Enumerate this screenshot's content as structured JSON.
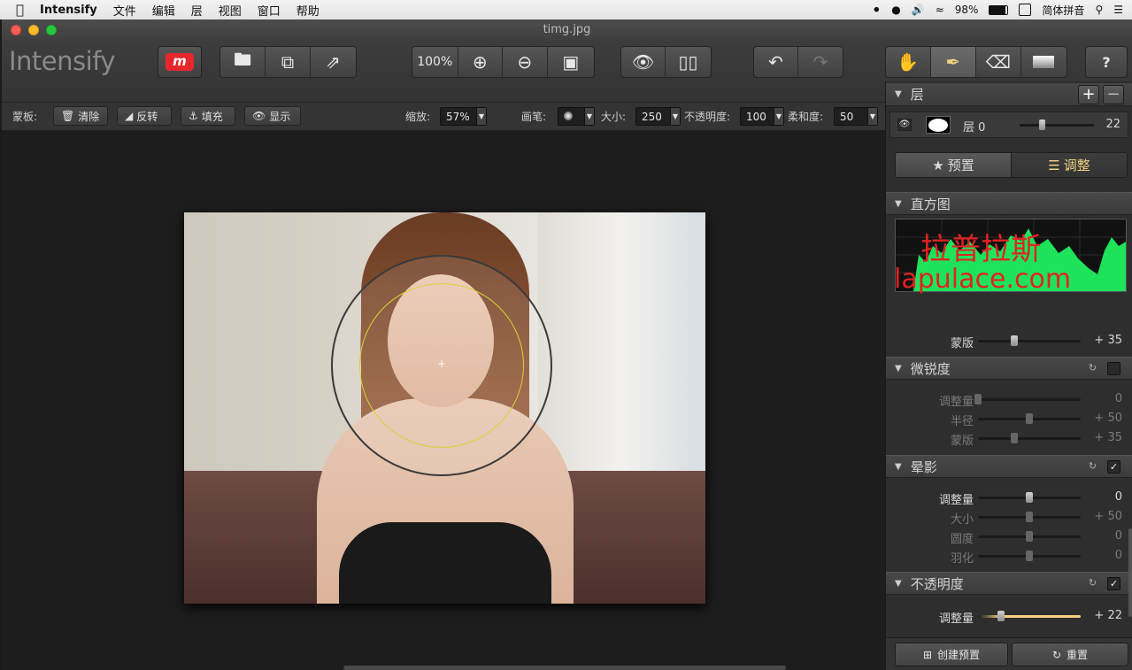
{
  "menubar": {
    "app": "Intensify",
    "menus": [
      "文件",
      "编辑",
      "层",
      "视图",
      "窗口",
      "帮助"
    ],
    "battery": "98%",
    "ime": "简体拼音"
  },
  "window": {
    "title": "timg.jpg"
  },
  "toolbar": {
    "logo": "Intensify",
    "zoom_label": "100%"
  },
  "optbar": {
    "mask_label": "蒙板:",
    "clear": "清除",
    "invert": "反转",
    "fill": "填充",
    "show": "显示",
    "zoom_label": "缩放:",
    "zoom_value": "57%",
    "brush_label": "画笔:",
    "size_label": "大小:",
    "size_value": "250",
    "opacity_label": "不透明度:",
    "opacity_value": "100",
    "softness_label": "柔和度:",
    "softness_value": "50"
  },
  "layers": {
    "title": "层",
    "layer_name": "层 0",
    "layer_value": "22",
    "layer_level": 0.3
  },
  "tabs": {
    "presets": "预置",
    "adjust": "调整"
  },
  "histogram": {
    "title": "直方图",
    "watermark_cn": "拉普拉斯",
    "watermark_en": "lapulace.com"
  },
  "mask_row": {
    "label": "蒙版",
    "value": "+ 35",
    "level": 0.35
  },
  "sharpness": {
    "title": "微锐度",
    "rows": [
      {
        "label": "调整量",
        "value": "0",
        "level": 0.0
      },
      {
        "label": "半径",
        "value": "+ 50",
        "level": 0.5
      },
      {
        "label": "蒙版",
        "value": "+ 35",
        "level": 0.35
      }
    ]
  },
  "vignette": {
    "title": "晕影",
    "rows": [
      {
        "label": "调整量",
        "value": "0",
        "level": 0.5
      },
      {
        "label": "大小",
        "value": "+ 50",
        "level": 0.5
      },
      {
        "label": "圆度",
        "value": "0",
        "level": 0.5
      },
      {
        "label": "羽化",
        "value": "0",
        "level": 0.5
      }
    ]
  },
  "opacity": {
    "title": "不透明度",
    "rows": [
      {
        "label": "调整量",
        "value": "+ 22",
        "level": 0.22
      }
    ]
  },
  "bottom": {
    "create_preset": "创建预置",
    "reset": "重置"
  },
  "colors": {
    "accent": "#f0d080",
    "histogram": "#1ee35a",
    "watermark": "#e02323"
  }
}
